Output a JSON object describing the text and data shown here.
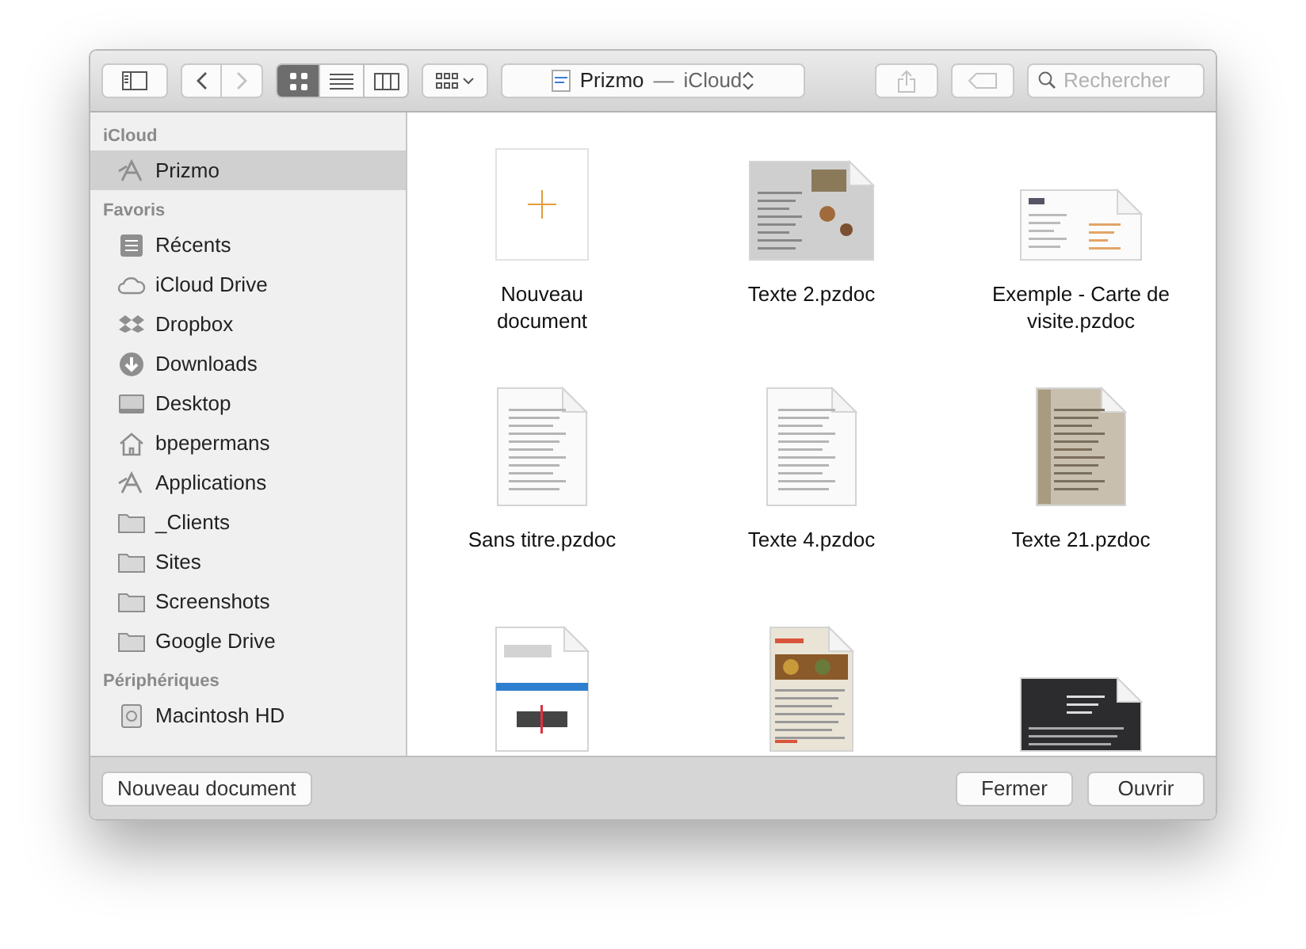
{
  "toolbar": {
    "nav": [
      {
        "kind": "back",
        "disabled": false
      },
      {
        "kind": "forward",
        "disabled": true
      }
    ],
    "view_modes": [
      {
        "kind": "icons",
        "selected": true
      },
      {
        "kind": "list",
        "selected": false
      },
      {
        "kind": "columns",
        "selected": false
      }
    ],
    "location": {
      "name": "Prizmo",
      "separator": "—",
      "container": "iCloud"
    },
    "actions": [
      {
        "kind": "share",
        "disabled": true
      },
      {
        "kind": "tag",
        "disabled": true
      }
    ],
    "search": {
      "placeholder": "Rechercher"
    }
  },
  "sidebar": {
    "sections": [
      {
        "title": "iCloud",
        "items": [
          {
            "label": "Prizmo",
            "kind": "app",
            "selected": true
          }
        ]
      },
      {
        "title": "Favoris",
        "items": [
          {
            "label": "Récents",
            "kind": "recents",
            "selected": false
          },
          {
            "label": "iCloud Drive",
            "kind": "cloud",
            "selected": false
          },
          {
            "label": "Dropbox",
            "kind": "dropbox",
            "selected": false
          },
          {
            "label": "Downloads",
            "kind": "download",
            "selected": false
          },
          {
            "label": "Desktop",
            "kind": "desktop",
            "selected": false
          },
          {
            "label": "bpepermans",
            "kind": "home",
            "selected": false
          },
          {
            "label": "Applications",
            "kind": "app",
            "selected": false
          },
          {
            "label": "_Clients",
            "kind": "folder",
            "selected": false
          },
          {
            "label": "Sites",
            "kind": "folder",
            "selected": false
          },
          {
            "label": "Screenshots",
            "kind": "folder",
            "selected": false
          },
          {
            "label": "Google Drive",
            "kind": "folder",
            "selected": false
          }
        ]
      },
      {
        "title": "Périphériques",
        "items": [
          {
            "label": "Macintosh HD",
            "kind": "disk",
            "selected": false
          }
        ]
      }
    ]
  },
  "files": [
    {
      "name": "Nouveau document",
      "kind": "new"
    },
    {
      "name": "Texte 2.pzdoc",
      "kind": "newspaper"
    },
    {
      "name": "Exemple - Carte de visite.pzdoc",
      "kind": "card"
    },
    {
      "name": "Sans titre.pzdoc",
      "kind": "page"
    },
    {
      "name": "Texte 4.pzdoc",
      "kind": "page"
    },
    {
      "name": "Texte 21.pzdoc",
      "kind": "scan"
    },
    {
      "kind": "abc"
    },
    {
      "kind": "magazine"
    },
    {
      "kind": "darkcard"
    }
  ],
  "footer": {
    "left_button": "Nouveau document",
    "buttons": [
      "Fermer",
      "Ouvrir"
    ]
  }
}
